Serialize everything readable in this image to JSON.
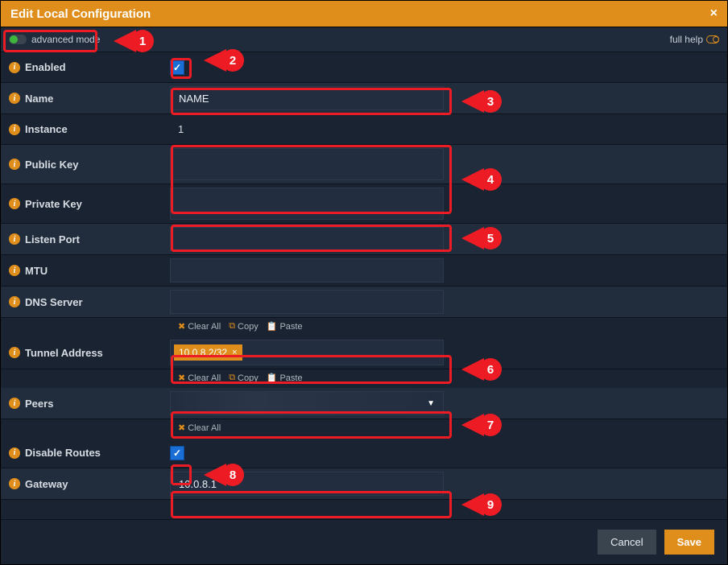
{
  "window": {
    "title": "Edit Local Configuration",
    "close_label": "×"
  },
  "topbar": {
    "advanced_mode_label": "advanced mode",
    "advanced_mode_on": true,
    "full_help_label": "full help"
  },
  "fields": {
    "enabled": {
      "label": "Enabled",
      "checked": true
    },
    "name": {
      "label": "Name",
      "value": "NAME"
    },
    "instance": {
      "label": "Instance",
      "value": "1"
    },
    "public_key": {
      "label": "Public Key",
      "value": ""
    },
    "private_key": {
      "label": "Private Key",
      "value": ""
    },
    "listen_port": {
      "label": "Listen Port",
      "value": ""
    },
    "mtu": {
      "label": "MTU",
      "value": ""
    },
    "dns_server": {
      "label": "DNS Server",
      "value": ""
    },
    "tunnel_address": {
      "label": "Tunnel Address",
      "tags": [
        "10.0.8.2/32"
      ]
    },
    "peers": {
      "label": "Peers",
      "selected": ""
    },
    "disable_routes": {
      "label": "Disable Routes",
      "checked": true
    },
    "gateway": {
      "label": "Gateway",
      "value": "10.0.8.1"
    }
  },
  "mini_actions": {
    "clear_all": "Clear All",
    "copy": "Copy",
    "paste": "Paste"
  },
  "buttons": {
    "cancel": "Cancel",
    "save": "Save"
  },
  "callouts": [
    "1",
    "2",
    "3",
    "4",
    "5",
    "6",
    "7",
    "8",
    "9"
  ]
}
